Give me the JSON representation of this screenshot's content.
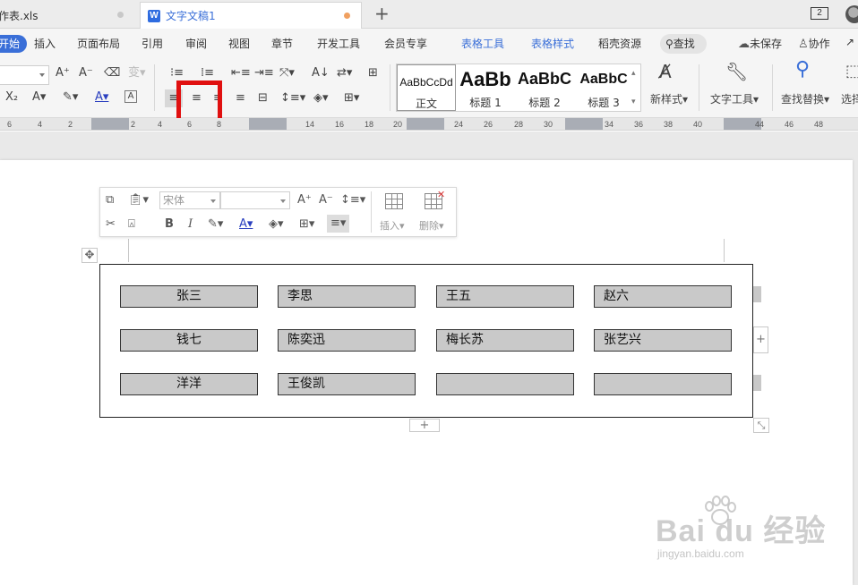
{
  "tabs": {
    "sheet_tab": "作表.xls",
    "doc_tab": "文字文稿1",
    "doc_icon": "W",
    "new_tab": "+",
    "page_count": "2"
  },
  "menu": {
    "items": [
      "开始",
      "插入",
      "页面布局",
      "引用",
      "审阅",
      "视图",
      "章节",
      "开发工具",
      "会员专享",
      "表格工具",
      "表格样式",
      "稻壳资源"
    ],
    "search": "查找",
    "unsaved": "未保存",
    "collab": "协作"
  },
  "ribbon": {
    "styles": [
      {
        "preview": "AaBbCcDd",
        "name": "正文"
      },
      {
        "preview": "AaBb",
        "name": "标题 1"
      },
      {
        "preview": "AaBbC",
        "name": "标题 2"
      },
      {
        "preview": "AaBbC",
        "name": "标题 3"
      }
    ],
    "new_style": "新样式",
    "text_tools": "文字工具",
    "find_replace": "查找替换",
    "select": "选择",
    "highlight_color": "#e01010"
  },
  "ruler": {
    "ticks": [
      "6",
      "4",
      "2",
      "2",
      "4",
      "6",
      "8",
      "14",
      "16",
      "18",
      "20",
      "24",
      "26",
      "28",
      "30",
      "34",
      "36",
      "38",
      "40",
      "44",
      "46",
      "48"
    ]
  },
  "mini_toolbar": {
    "font": "宋体",
    "size": "",
    "insert": "插入",
    "delete": "删除"
  },
  "table": {
    "rows": [
      [
        {
          "text": "张三",
          "align": "center"
        },
        {
          "text": "李思",
          "align": "left"
        },
        {
          "text": "王五",
          "align": "left"
        },
        {
          "text": "赵六",
          "align": "left"
        }
      ],
      [
        {
          "text": "钱七",
          "align": "center"
        },
        {
          "text": "陈奕迅",
          "align": "left"
        },
        {
          "text": "梅长苏",
          "align": "left"
        },
        {
          "text": "张艺兴",
          "align": "left"
        }
      ],
      [
        {
          "text": "洋洋",
          "align": "center"
        },
        {
          "text": "王俊凯",
          "align": "left"
        },
        {
          "text": "",
          "align": "left"
        },
        {
          "text": "",
          "align": "left"
        }
      ]
    ]
  },
  "watermark": {
    "brand": "Bai du 经验",
    "site": "jingyan.baidu.com"
  }
}
